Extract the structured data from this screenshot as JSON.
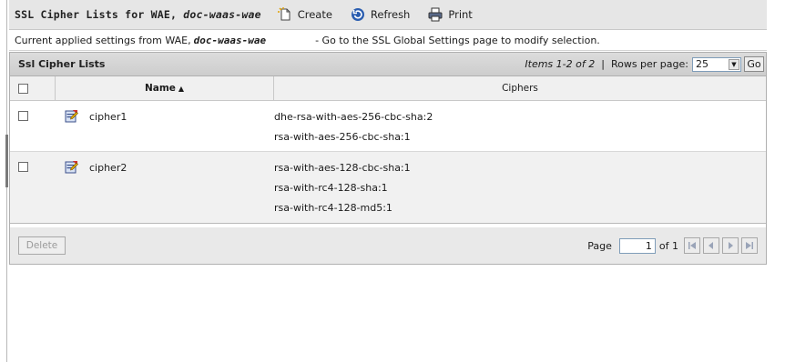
{
  "toolbar": {
    "title_prefix": "SSL Cipher Lists for WAE, ",
    "title_device": "doc-waas-wae",
    "create_label": "Create",
    "refresh_label": "Refresh",
    "print_label": "Print"
  },
  "infobar": {
    "text_prefix": "Current applied settings from WAE, ",
    "device": "doc-waas-wae",
    "hint": "- Go to the SSL Global Settings page to modify selection."
  },
  "table": {
    "title": "Ssl Cipher Lists",
    "items_text": "Items 1-2 of 2",
    "separator": "|",
    "rows_per_page_label": "Rows per page:",
    "rows_per_page_value": "25",
    "go_label": "Go",
    "columns": {
      "name": "Name",
      "sort_indicator": "▲",
      "ciphers": "Ciphers"
    },
    "rows": [
      {
        "name": "cipher1",
        "ciphers": [
          "dhe-rsa-with-aes-256-cbc-sha:2",
          "rsa-with-aes-256-cbc-sha:1"
        ]
      },
      {
        "name": "cipher2",
        "ciphers": [
          "rsa-with-aes-128-cbc-sha:1",
          "rsa-with-rc4-128-sha:1",
          "rsa-with-rc4-128-md5:1"
        ]
      }
    ],
    "delete_label": "Delete",
    "page_label": "Page",
    "page_value": "1",
    "of_label": "of 1"
  },
  "colors": {
    "toolbar_bg": "#e6e6e6",
    "header_bg": "#d4d4d4",
    "alt_row_bg": "#f1f1f1",
    "accent_blue": "#2a5db0"
  },
  "icons": {
    "create": "create-icon",
    "refresh": "refresh-icon",
    "print": "printer-icon",
    "edit": "edit-icon"
  }
}
